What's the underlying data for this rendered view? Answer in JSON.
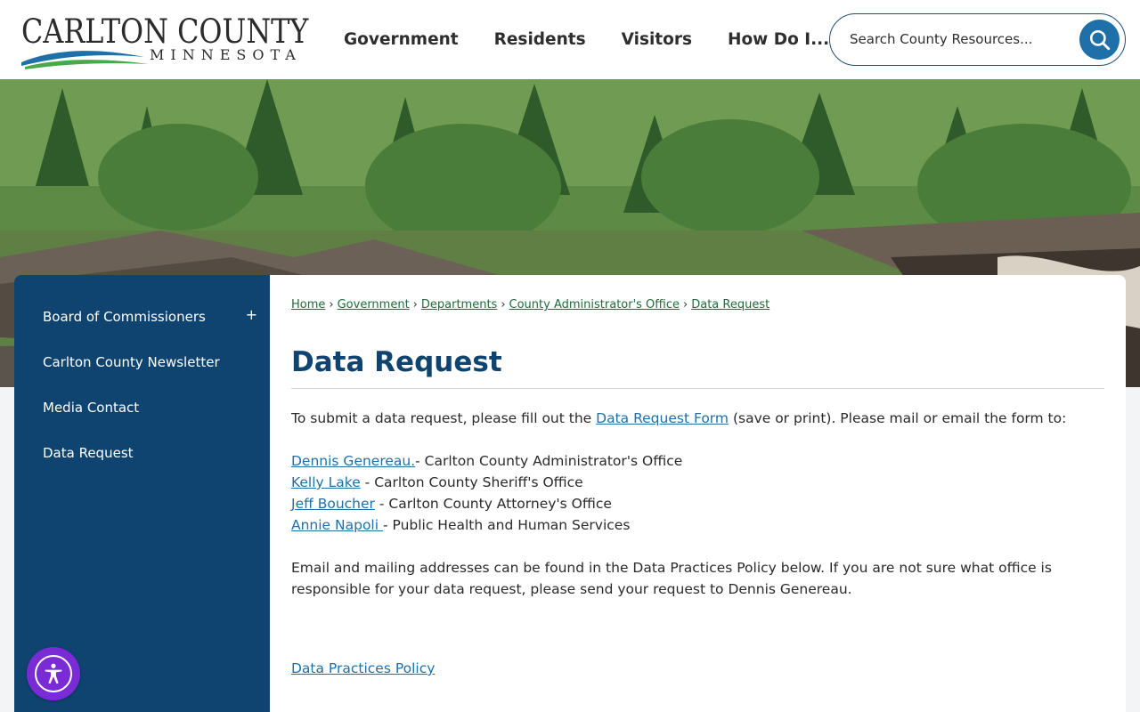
{
  "logo": {
    "title": "CARLTON COUNTY",
    "subtitle": "MINNESOTA"
  },
  "nav": {
    "items": [
      {
        "label": "Government"
      },
      {
        "label": "Residents"
      },
      {
        "label": "Visitors"
      },
      {
        "label": "How Do I..."
      }
    ]
  },
  "search": {
    "placeholder": "Search County Resources..."
  },
  "sidebar": {
    "items": [
      {
        "label": "Board of Commissioners",
        "expander": "+"
      },
      {
        "label": "Carlton County Newsletter"
      },
      {
        "label": "Media Contact"
      },
      {
        "label": "Data Request"
      }
    ]
  },
  "breadcrumb": {
    "items": [
      "Home",
      "Government",
      "Departments",
      "County Administrator's Office",
      "Data Request"
    ],
    "separator": "›"
  },
  "page": {
    "title": "Data Request",
    "intro_before": "To submit a data request, please fill out the ",
    "intro_link": "Data Request Form",
    "intro_after": " (save or print). Please mail or email the form to:",
    "contacts": [
      {
        "name": "Dennis Genereau.",
        "office": "- Carlton County Administrator's Office"
      },
      {
        "name": "Kelly Lake",
        "office": " - Carlton County Sheriff's Office"
      },
      {
        "name": "Jeff Boucher",
        "office": " - Carlton County Attorney's Office"
      },
      {
        "name": "Annie Napoli ",
        "office": "- Public Health and Human Services"
      }
    ],
    "note": "Email and mailing addresses can be found in the Data Practices Policy below. If you are not sure what office is responsible for your data request, please send your request to Dennis Genereau.",
    "policy_link": "Data Practices Policy"
  },
  "colors": {
    "brand_navy": "#0f4471",
    "link_blue": "#1f6fa9",
    "breadcrumb_green": "#1f6b3a",
    "accessibility_purple": "#7a2bd6"
  },
  "icons": {
    "search": "search-icon",
    "accessibility": "accessibility-icon"
  }
}
